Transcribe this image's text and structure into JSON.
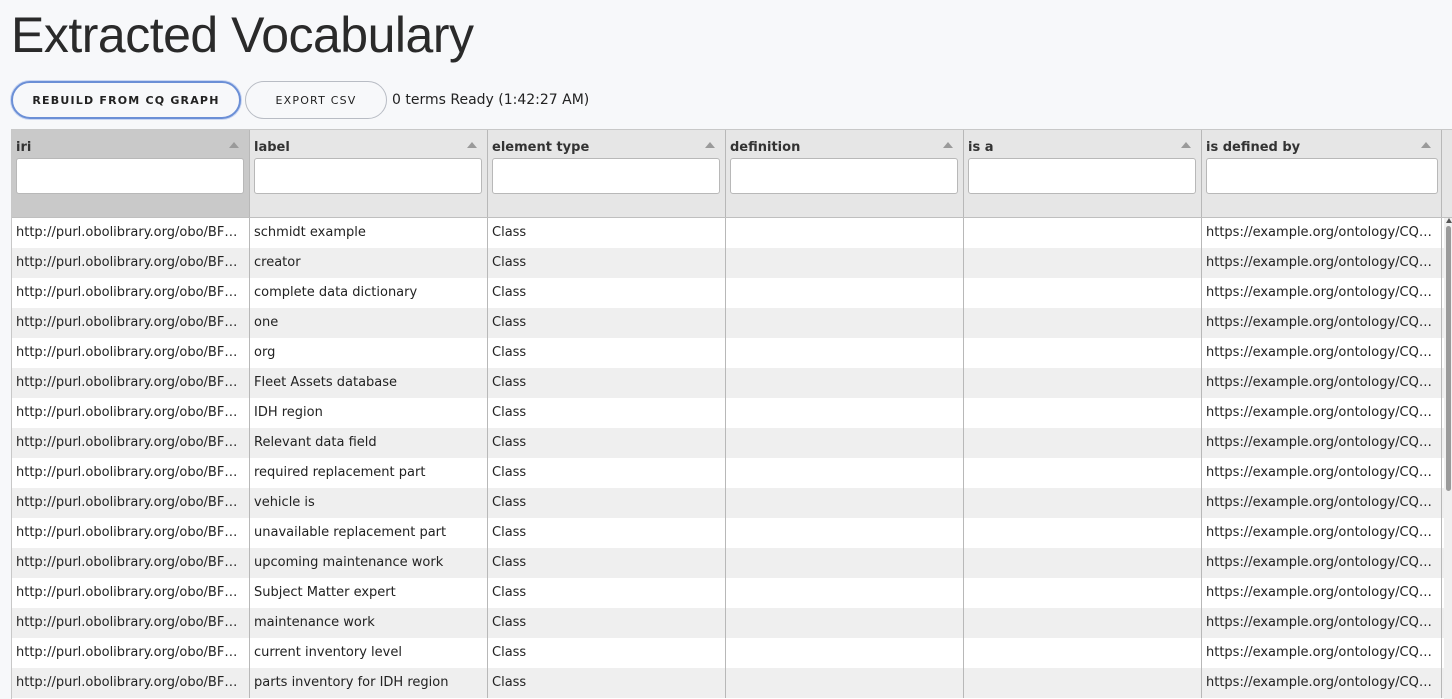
{
  "page_title": "Extracted Vocabulary",
  "toolbar": {
    "rebuild_label": "REBUILD FROM CQ GRAPH",
    "export_label": "EXPORT CSV",
    "status": "0 terms Ready (1:42:27 AM)"
  },
  "columns": [
    "iri",
    "label",
    "element type",
    "definition",
    "is a",
    "is defined by"
  ],
  "rows": [
    [
      "http://purl.obolibrary.org/obo/BFO...",
      "schmidt example",
      "Class",
      "",
      "",
      "https://example.org/ontology/CQD..."
    ],
    [
      "http://purl.obolibrary.org/obo/BFO...",
      "creator",
      "Class",
      "",
      "",
      "https://example.org/ontology/CQD..."
    ],
    [
      "http://purl.obolibrary.org/obo/BFO...",
      "complete data dictionary",
      "Class",
      "",
      "",
      "https://example.org/ontology/CQD..."
    ],
    [
      "http://purl.obolibrary.org/obo/BFO...",
      "one",
      "Class",
      "",
      "",
      "https://example.org/ontology/CQD..."
    ],
    [
      "http://purl.obolibrary.org/obo/BFO...",
      "org",
      "Class",
      "",
      "",
      "https://example.org/ontology/CQD..."
    ],
    [
      "http://purl.obolibrary.org/obo/BFO...",
      "Fleet Assets database",
      "Class",
      "",
      "",
      "https://example.org/ontology/CQD..."
    ],
    [
      "http://purl.obolibrary.org/obo/BFO...",
      "IDH region",
      "Class",
      "",
      "",
      "https://example.org/ontology/CQD..."
    ],
    [
      "http://purl.obolibrary.org/obo/BFO...",
      "Relevant data field",
      "Class",
      "",
      "",
      "https://example.org/ontology/CQD..."
    ],
    [
      "http://purl.obolibrary.org/obo/BFO...",
      "required replacement part",
      "Class",
      "",
      "",
      "https://example.org/ontology/CQD..."
    ],
    [
      "http://purl.obolibrary.org/obo/BFO...",
      "vehicle is",
      "Class",
      "",
      "",
      "https://example.org/ontology/CQD..."
    ],
    [
      "http://purl.obolibrary.org/obo/BFO...",
      "unavailable replacement part",
      "Class",
      "",
      "",
      "https://example.org/ontology/CQD..."
    ],
    [
      "http://purl.obolibrary.org/obo/BFO...",
      "upcoming maintenance work",
      "Class",
      "",
      "",
      "https://example.org/ontology/CQD..."
    ],
    [
      "http://purl.obolibrary.org/obo/BFO...",
      "Subject Matter expert",
      "Class",
      "",
      "",
      "https://example.org/ontology/CQD..."
    ],
    [
      "http://purl.obolibrary.org/obo/BFO...",
      "maintenance work",
      "Class",
      "",
      "",
      "https://example.org/ontology/CQD..."
    ],
    [
      "http://purl.obolibrary.org/obo/BFO...",
      "current inventory level",
      "Class",
      "",
      "",
      "https://example.org/ontology/CQD..."
    ],
    [
      "http://purl.obolibrary.org/obo/BFO...",
      "parts inventory for IDH region",
      "Class",
      "",
      "",
      "https://example.org/ontology/CQD..."
    ]
  ],
  "icons": {
    "sort": "sort-asc-icon"
  },
  "colors": {
    "accent": "#6b8fd6",
    "header_bg": "#e6e6e6",
    "sorted_header_bg": "#c9c9c9"
  }
}
